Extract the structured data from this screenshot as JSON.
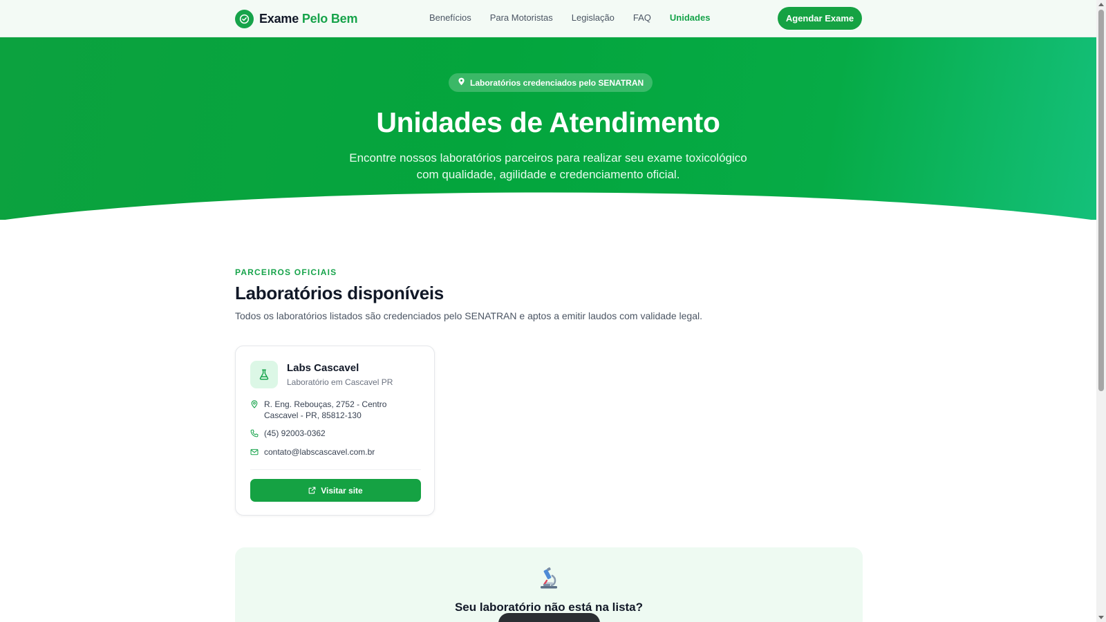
{
  "header": {
    "logo_main": "Exame",
    "logo_accent": "Pelo Bem",
    "logo_icon": "check-circle-icon",
    "nav": [
      {
        "label": "Benefícios",
        "active": false
      },
      {
        "label": "Para Motoristas",
        "active": false
      },
      {
        "label": "Legislação",
        "active": false
      },
      {
        "label": "FAQ",
        "active": false
      },
      {
        "label": "Unidades",
        "active": true
      }
    ],
    "cta_label": "Agendar Exame"
  },
  "hero": {
    "badge_icon": "map-pin-icon",
    "badge": "Laboratórios credenciados pelo SENATRAN",
    "title": "Unidades de Atendimento",
    "subtitle": "Encontre nossos laboratórios parceiros para realizar seu exame toxicológico com qualidade, agilidade e credenciamento oficial."
  },
  "section": {
    "kicker": "PARCEIROS OFICIAIS",
    "title": "Laboratórios disponíveis",
    "description": "Todos os laboratórios listados são credenciados pelo SENATRAN e aptos a emitir laudos com validade legal."
  },
  "labs": [
    {
      "icon": "flask-icon",
      "name": "Labs Cascavel",
      "subtitle": "Laboratório em Cascavel PR",
      "address_line1": "R. Eng. Rebouças, 2752 - Centro",
      "address_line2": "Cascavel - PR, 85812-130",
      "phone": "(45) 92003-0362",
      "email": "contato@labscascavel.com.br",
      "visit_label": "Visitar site"
    }
  ],
  "panel": {
    "icon": "microscope-icon",
    "title": "Seu laboratório não está na lista?"
  },
  "colors": {
    "brand": "#16a34a",
    "hero_start": "#0ca23f",
    "hero_end": "#14c07a",
    "panel_bg": "#eefaf2"
  }
}
